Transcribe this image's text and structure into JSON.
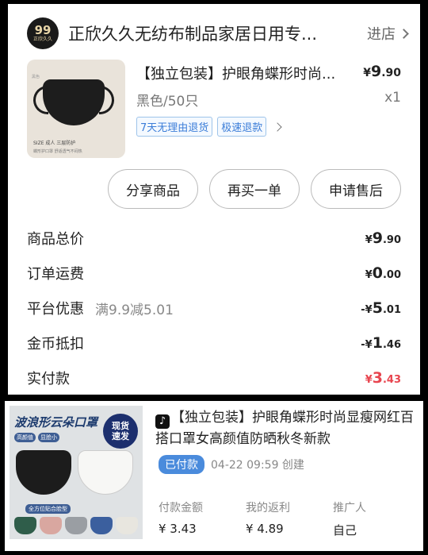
{
  "shop": {
    "logo_num": "99",
    "logo_text": "正欣久久",
    "name": "正欣久久无纺布制品家居日用专...",
    "enter_label": "进店"
  },
  "product": {
    "image_tag": "黑色",
    "image_caption1": "SIZE 成人   三层防护",
    "image_caption2": "蝶形护口罩   舒适透气不闷热",
    "title": "【独立包装】护眼角蝶形时尚...",
    "price_symbol": "¥",
    "price_int": "9",
    "price_dec": ".90",
    "spec": "黑色/50只",
    "qty": "x1",
    "badges": [
      "7天无理由退货",
      "极速退款"
    ]
  },
  "actions": [
    "分享商品",
    "再买一单",
    "申请售后"
  ],
  "summary": [
    {
      "label": "商品总价",
      "note": "",
      "prefix": "¥",
      "int": "9",
      "dec": ".90",
      "red": false
    },
    {
      "label": "订单运费",
      "note": "",
      "prefix": "¥",
      "int": "0",
      "dec": ".00",
      "red": false
    },
    {
      "label": "平台优惠",
      "note": "满9.9减5.01",
      "prefix": "-¥",
      "int": "5",
      "dec": ".01",
      "red": false
    },
    {
      "label": "金币抵扣",
      "note": "",
      "prefix": "-¥",
      "int": "1",
      "dec": ".46",
      "red": false
    },
    {
      "label": "实付款",
      "note": "",
      "prefix": "¥",
      "int": "3",
      "dec": ".43",
      "red": true
    }
  ],
  "card2": {
    "image_headline": "波浪形云朵口罩",
    "image_hot": [
      "现货",
      "速发"
    ],
    "image_pills": [
      "高颜值",
      "显脸小"
    ],
    "image_caption": "全方位贴合脸型",
    "swatch_colors": [
      "#2f5d4a",
      "#d9a7a0",
      "#9a9ea3",
      "#3b5f9e",
      "#e8e6df"
    ],
    "tiktok_glyph": "♪",
    "title": "【独立包装】护眼角蝶形时尚显瘦网红百搭口罩女高颜值防晒秋冬新款",
    "status": "已付款",
    "time": "04-22 09:59 创建",
    "stats": [
      {
        "label": "付款金额",
        "value": "¥ 3.43"
      },
      {
        "label": "我的返利",
        "value": "¥ 4.89"
      },
      {
        "label": "推广人",
        "value": "自己"
      }
    ]
  }
}
